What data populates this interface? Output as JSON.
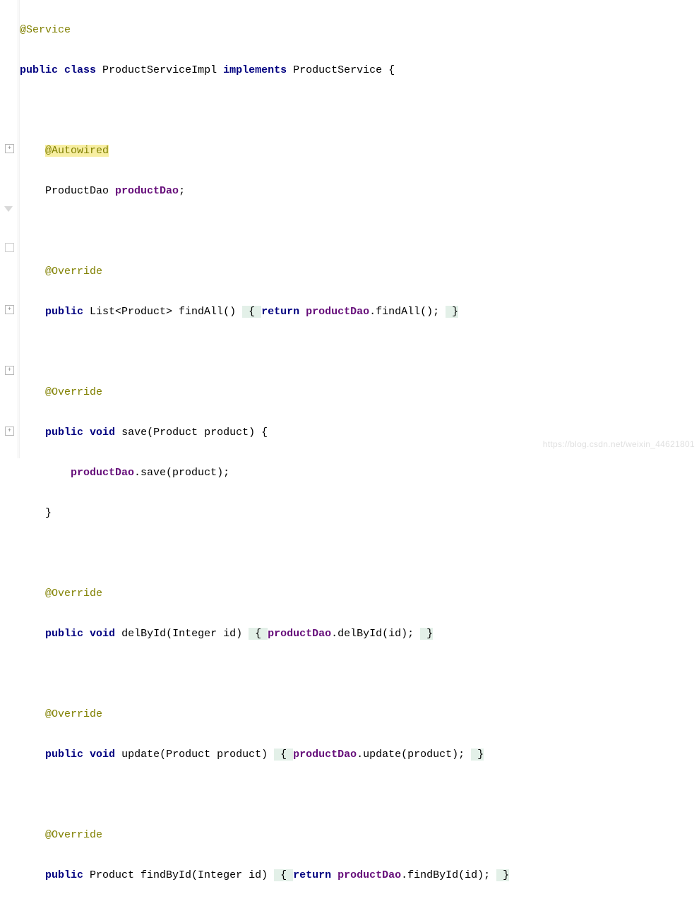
{
  "code": {
    "line1": {
      "ann": "@Service"
    },
    "line2": {
      "kw1": "public",
      "kw2": "class",
      "cls": " ProductServiceImpl ",
      "kw3": "implements",
      "rest": " ProductService {"
    },
    "line4": {
      "ann": "@Autowired"
    },
    "line5": {
      "typ": "ProductDao ",
      "field": "productDao",
      "semi": ";"
    },
    "line7": {
      "ann": "@Override"
    },
    "line8": {
      "kw1": "public",
      "typ": " List<Product> findAll() ",
      "br1": " { ",
      "kw2": "return",
      "sp": " ",
      "field": "productDao",
      "rest": ".findAll(); ",
      "br2": " }"
    },
    "line10": {
      "ann": "@Override"
    },
    "line11": {
      "kw1": "public",
      "kw2": "void",
      "rest": " save(Product product) {"
    },
    "line12": {
      "indent": "    ",
      "field": "productDao",
      "rest": ".save(product);"
    },
    "line13": {
      "txt": "}"
    },
    "line15": {
      "ann": "@Override"
    },
    "line16": {
      "kw1": "public",
      "kw2": "void",
      "sig": " delById(Integer id) ",
      "br1": " { ",
      "field": "productDao",
      "rest": ".delById(id); ",
      "br2": " }"
    },
    "line18": {
      "ann": "@Override"
    },
    "line19": {
      "kw1": "public",
      "kw2": "void",
      "sig": " update(Product product) ",
      "br1": " { ",
      "field": "productDao",
      "rest": ".update(product); ",
      "br2": " }"
    },
    "line21": {
      "ann": "@Override"
    },
    "line22": {
      "kw1": "public",
      "typ": " Product findById(Integer id) ",
      "br1": " { ",
      "kw2": "return",
      "sp": " ",
      "field": "productDao",
      "rest": ".findById(id); ",
      "br2": " }"
    }
  },
  "watermark": "https://blog.csdn.net/weixin_44621801"
}
